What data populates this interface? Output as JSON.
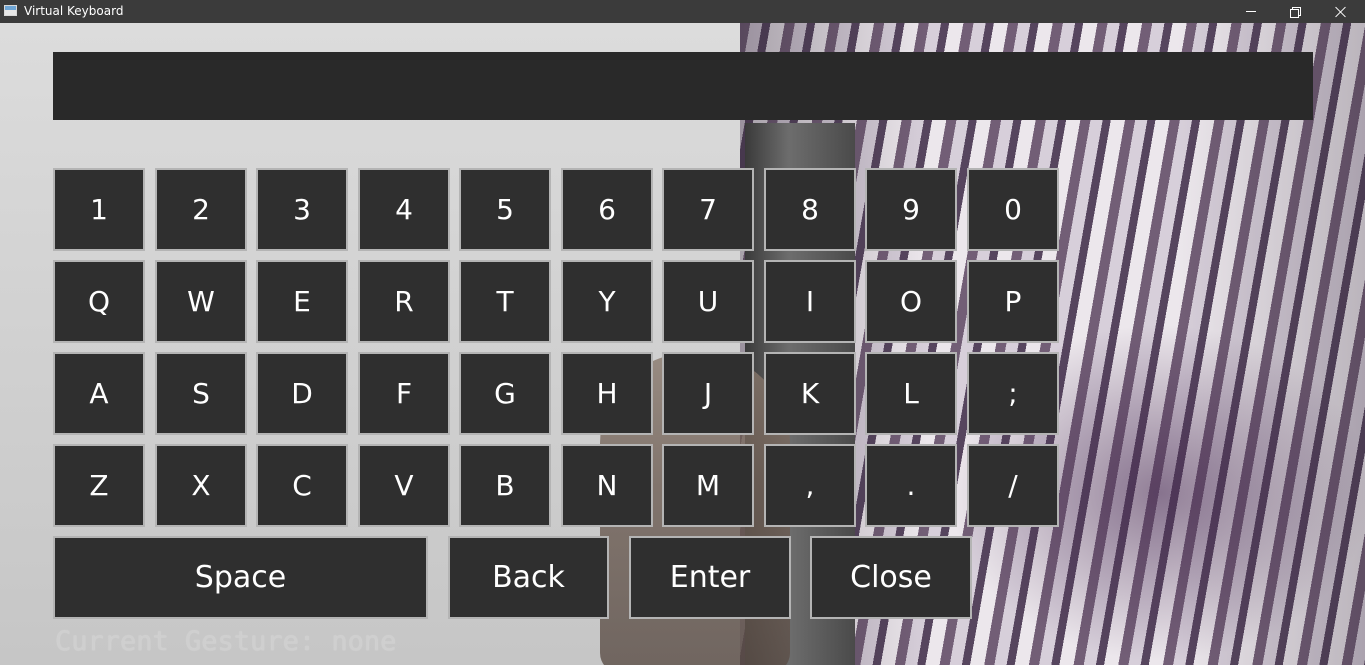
{
  "window": {
    "title": "Virtual Keyboard",
    "controls": [
      "minimize",
      "maximize",
      "close"
    ]
  },
  "text_display": {
    "value": ""
  },
  "keyboard": {
    "rows": [
      [
        "1",
        "2",
        "3",
        "4",
        "5",
        "6",
        "7",
        "8",
        "9",
        "0"
      ],
      [
        "Q",
        "W",
        "E",
        "R",
        "T",
        "Y",
        "U",
        "I",
        "O",
        "P"
      ],
      [
        "A",
        "S",
        "D",
        "F",
        "G",
        "H",
        "J",
        "K",
        "L",
        ";"
      ],
      [
        "Z",
        "X",
        "C",
        "V",
        "B",
        "N",
        "M",
        ",",
        ".",
        "/"
      ]
    ],
    "action_keys": {
      "space": "Space",
      "back": "Back",
      "enter": "Enter",
      "close": "Close"
    }
  },
  "status": {
    "gesture_text": "Current Gesture: none"
  },
  "colors": {
    "key_background": "#2f2f2f",
    "key_border": "#b4b4b4",
    "key_text": "#ffffff",
    "display_background": "#292929",
    "status_text": "#cfcfcf",
    "titlebar": "#3b3b3b"
  }
}
